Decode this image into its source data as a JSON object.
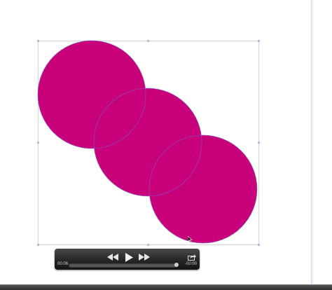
{
  "colors": {
    "circle_fill": "#c8007a",
    "circle_stroke": "#7a5cc8",
    "guide": "#c9cdf2",
    "player_bg": "#262626"
  },
  "player": {
    "elapsed": "00:06",
    "remaining": "-00:00",
    "progress": 1.0,
    "icons": [
      "rewind-icon",
      "play-icon",
      "fast-forward-icon",
      "share-icon"
    ]
  }
}
